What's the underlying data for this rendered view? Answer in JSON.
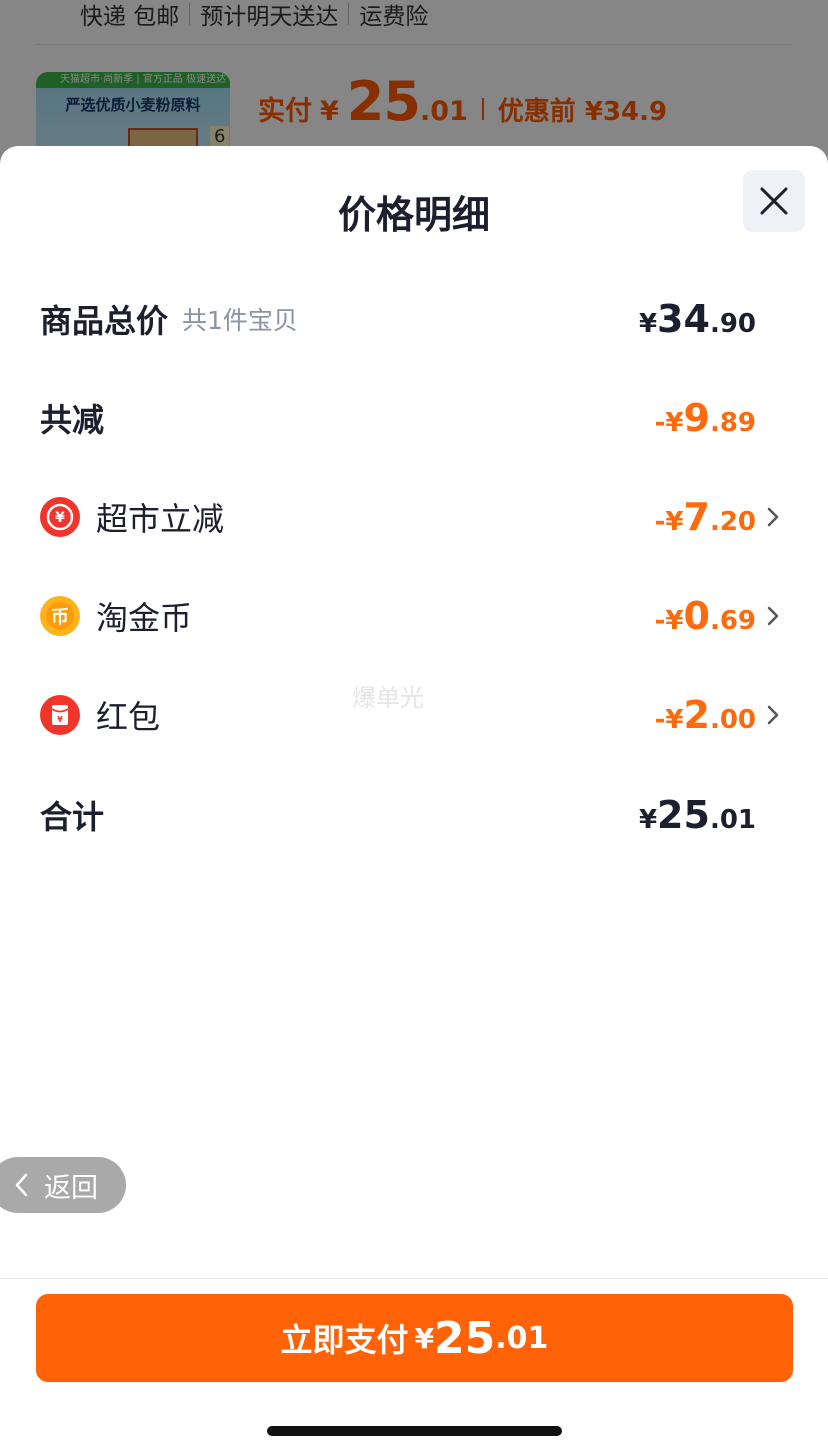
{
  "background": {
    "shipping_items": [
      "快递 包邮",
      "预计明天送达",
      "运费险"
    ],
    "thumbnail": {
      "badge_text": "天猫超市·尚新季 | 官方正品 极速送达",
      "title": "严选优质小麦粉原料",
      "count": "6"
    },
    "price": {
      "label": "实付",
      "currency": "¥",
      "integer": "25",
      "decimal": ".01",
      "original": "优惠前 ¥34.9"
    }
  },
  "sheet": {
    "title": "价格明细",
    "close_icon": "close-icon",
    "rows": [
      {
        "label": "商品总价",
        "sub": "共1件宝贝",
        "currency": "¥",
        "integer": "34",
        "decimal": ".90"
      },
      {
        "label": "共减",
        "currency": "-¥",
        "integer": "9",
        "decimal": ".89"
      },
      {
        "label": "超市立减",
        "icon": "yuan-down-icon",
        "currency": "-¥",
        "integer": "7",
        "decimal": ".20"
      },
      {
        "label": "淘金币",
        "icon": "coin-icon",
        "currency": "-¥",
        "integer": "0",
        "decimal": ".69"
      },
      {
        "label": "红包",
        "icon": "red-packet-icon",
        "currency": "-¥",
        "integer": "2",
        "decimal": ".00"
      },
      {
        "label": "合计",
        "currency": "¥",
        "integer": "25",
        "decimal": ".01"
      }
    ],
    "watermark": "爆单光"
  },
  "back_button": {
    "label": "返回"
  },
  "pay_button": {
    "label": "立即支付",
    "currency": "¥",
    "integer": "25",
    "decimal": ".01"
  },
  "colors": {
    "accent": "#ff6207",
    "discount": "#ff6a0c",
    "text": "#1c1f2e",
    "sub_text": "#8a93a6"
  }
}
